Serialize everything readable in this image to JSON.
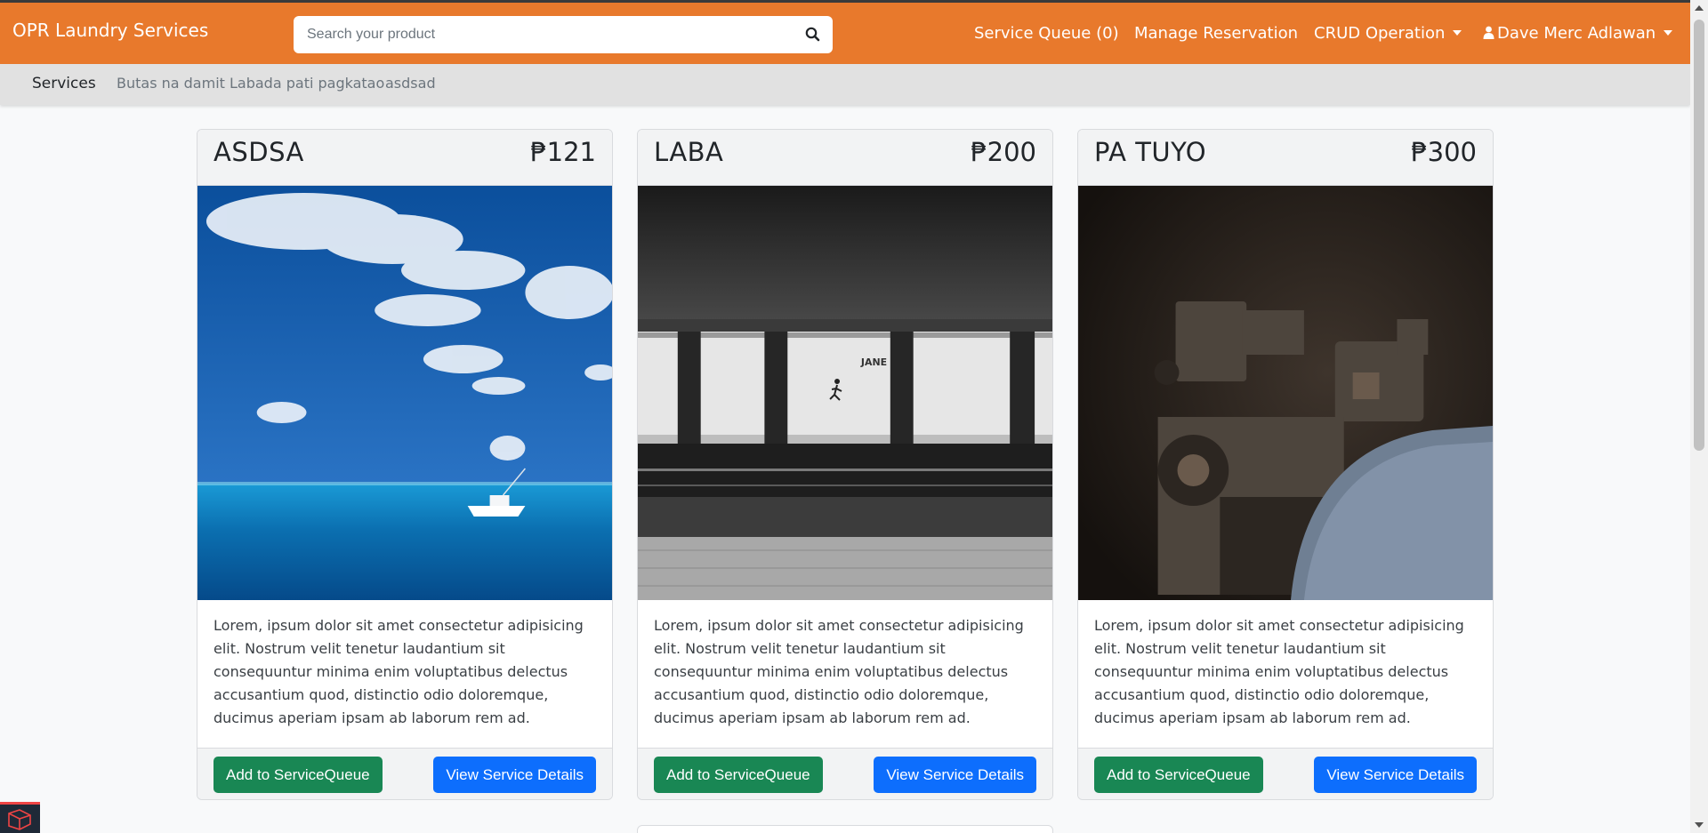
{
  "navbar": {
    "brand": "OPR Laundry Services",
    "search_placeholder": "Search your product",
    "service_queue": "Service Queue (0)",
    "manage_reservation": "Manage Reservation",
    "crud_operation": "CRUD Operation",
    "user_name": "Dave Merc Adlawan",
    "bg_color": "#e8792c"
  },
  "subnav": {
    "title": "Services",
    "links": [
      "Butas na damit",
      "Labada pati pagkatao",
      "asdsad"
    ]
  },
  "cards": [
    {
      "title": "ASDSA",
      "price": "₱121",
      "description": "Lorem, ipsum dolor sit amet consectetur adipisicing elit. Nostrum velit tenetur laudantium sit consequuntur minima enim voluptatibus delectus accusantium quod, distinctio odio doloremque, ducimus aperiam ipsam ab laborum rem ad.",
      "add_label": "Add to ServiceQueue",
      "view_label": "View Service Details"
    },
    {
      "title": "LABA",
      "price": "₱200",
      "description": "Lorem, ipsum dolor sit amet consectetur adipisicing elit. Nostrum velit tenetur laudantium sit consequuntur minima enim voluptatibus delectus accusantium quod, distinctio odio doloremque, ducimus aperiam ipsam ab laborum rem ad.",
      "add_label": "Add to ServiceQueue",
      "view_label": "View Service Details",
      "image_sign": "JANE"
    },
    {
      "title": "PA TUYO",
      "price": "₱300",
      "description": "Lorem, ipsum dolor sit amet consectetur adipisicing elit. Nostrum velit tenetur laudantium sit consequuntur minima enim voluptatibus delectus accusantium quod, distinctio odio doloremque, ducimus aperiam ipsam ab laborum rem ad.",
      "add_label": "Add to ServiceQueue",
      "view_label": "View Service Details"
    }
  ],
  "colors": {
    "success": "#198754",
    "primary": "#0d6efd"
  }
}
